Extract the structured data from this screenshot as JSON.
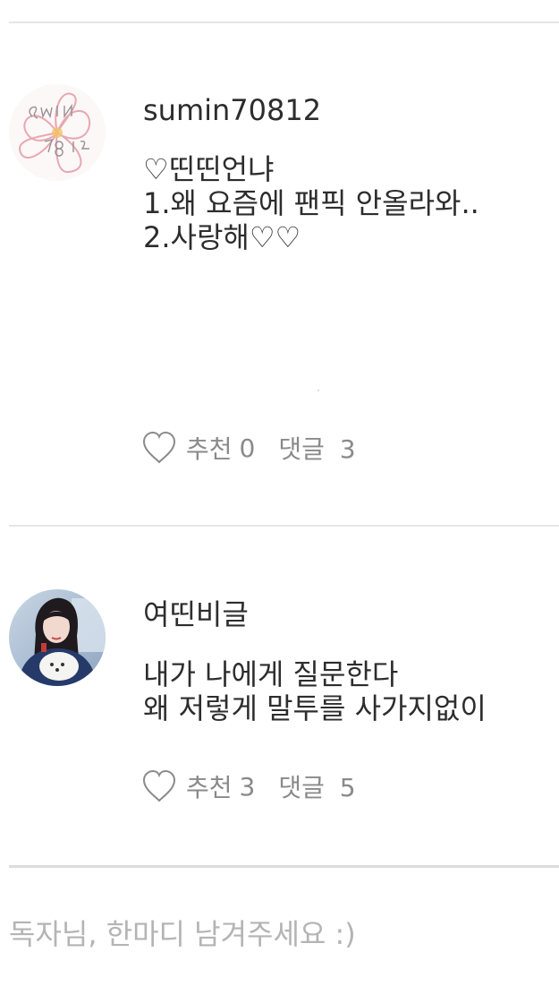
{
  "comments": [
    {
      "username": "sumin70812",
      "avatar": "hand-drawn-flower-sketch",
      "lines": [
        "♡띤띤언냐",
        "1.왜 요즘에 팬픽 안올라와..",
        "2.사랑해♡♡"
      ],
      "like_label": "추천",
      "like_count": "0",
      "reply_label": "댓글",
      "reply_count": "3"
    },
    {
      "username": "여띤비글",
      "avatar": "photo-girl-holding-white-puppy",
      "lines": [
        "내가 나에게 질문한다",
        "왜 저렇게 말투를 사가지없이"
      ],
      "like_label": "추천",
      "like_count": "3",
      "reply_label": "댓글",
      "reply_count": "5"
    }
  ],
  "input": {
    "placeholder": "독자님, 한마디 남겨주세요 :)"
  },
  "colors": {
    "text": "#2d2d2d",
    "muted": "#8a8a8a",
    "placeholder": "#b4b4b4",
    "divider": "#e6e6e6"
  }
}
